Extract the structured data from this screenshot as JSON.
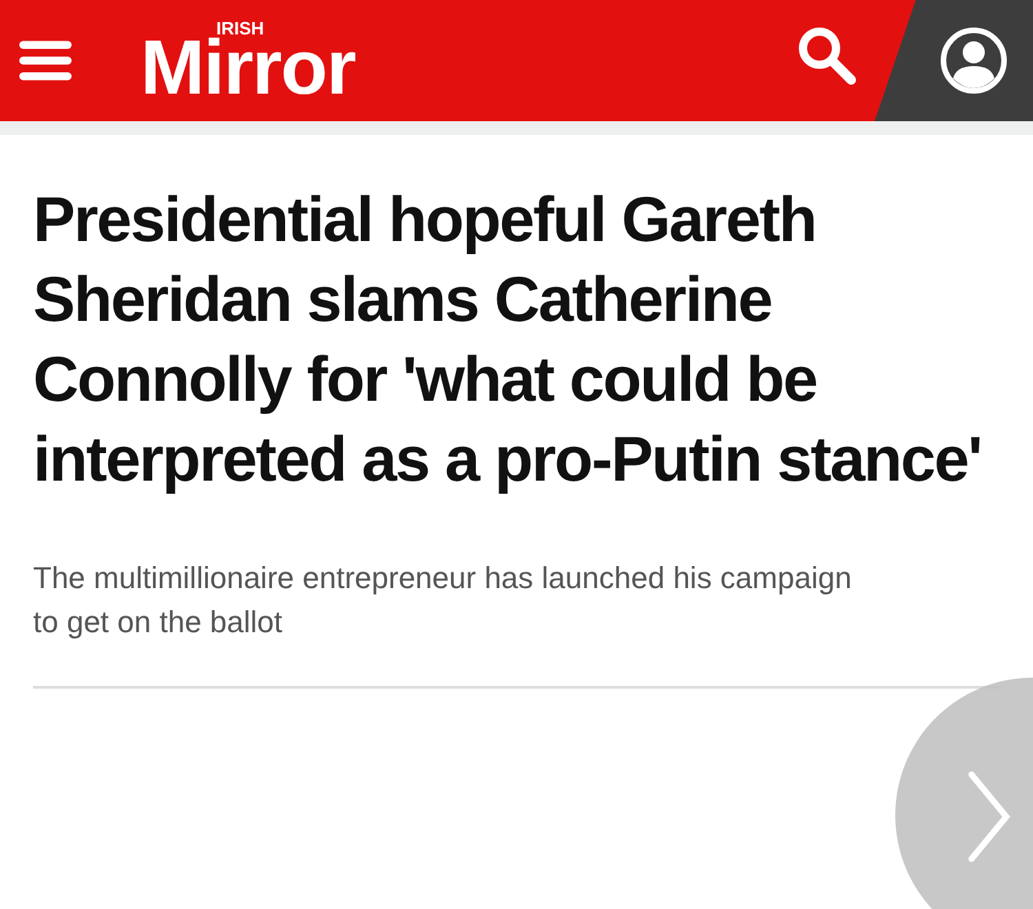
{
  "header": {
    "logo_small": "IRISH",
    "logo": "Mirror"
  },
  "article": {
    "headline": "Presidential hopeful Gareth Sheridan slams Catherine Connolly for 'what could be interpreted as a pro-Putin stance'",
    "standfirst": "The multimillionaire entrepreneur has launched his campaign to get on the ballot"
  }
}
